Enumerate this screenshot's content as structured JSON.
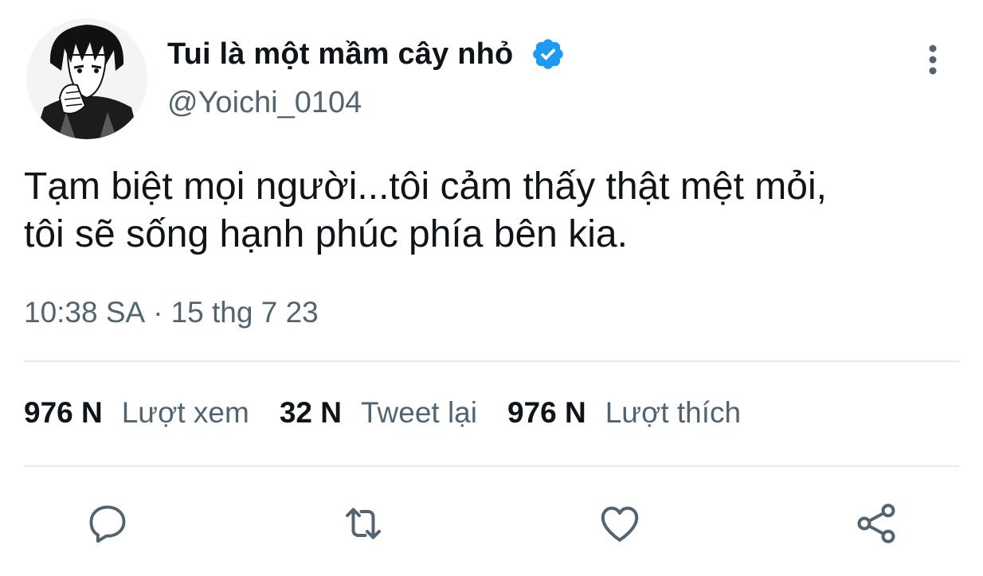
{
  "colors": {
    "accent": "#1d9bf0",
    "text_primary": "#0f1419",
    "text_secondary": "#536471",
    "divider": "#e7e9ea"
  },
  "user": {
    "display_name": "Tui là một mầm cây nhỏ",
    "handle": "@Yoichi_0104",
    "verified": true,
    "avatar": "manga-character-avatar"
  },
  "tweet": {
    "text_line1": "Tạm biệt mọi người...tôi cảm thấy thật mệt mỏi,",
    "text_line2": "tôi sẽ sống hạnh phúc phía bên kia.",
    "time": "10:38 SA",
    "separator": "·",
    "date": "15 thg 7 23"
  },
  "stats": [
    {
      "value": "976 N",
      "label": "Lượt xem"
    },
    {
      "value": "32 N",
      "label": "Tweet lại"
    },
    {
      "value": "976 N",
      "label": "Lượt thích"
    }
  ],
  "actions": [
    {
      "icon": "reply-icon"
    },
    {
      "icon": "retweet-icon"
    },
    {
      "icon": "like-icon"
    },
    {
      "icon": "share-icon"
    }
  ],
  "more_icon": "more-vertical-icon",
  "verified_icon": "verified-badge-icon"
}
